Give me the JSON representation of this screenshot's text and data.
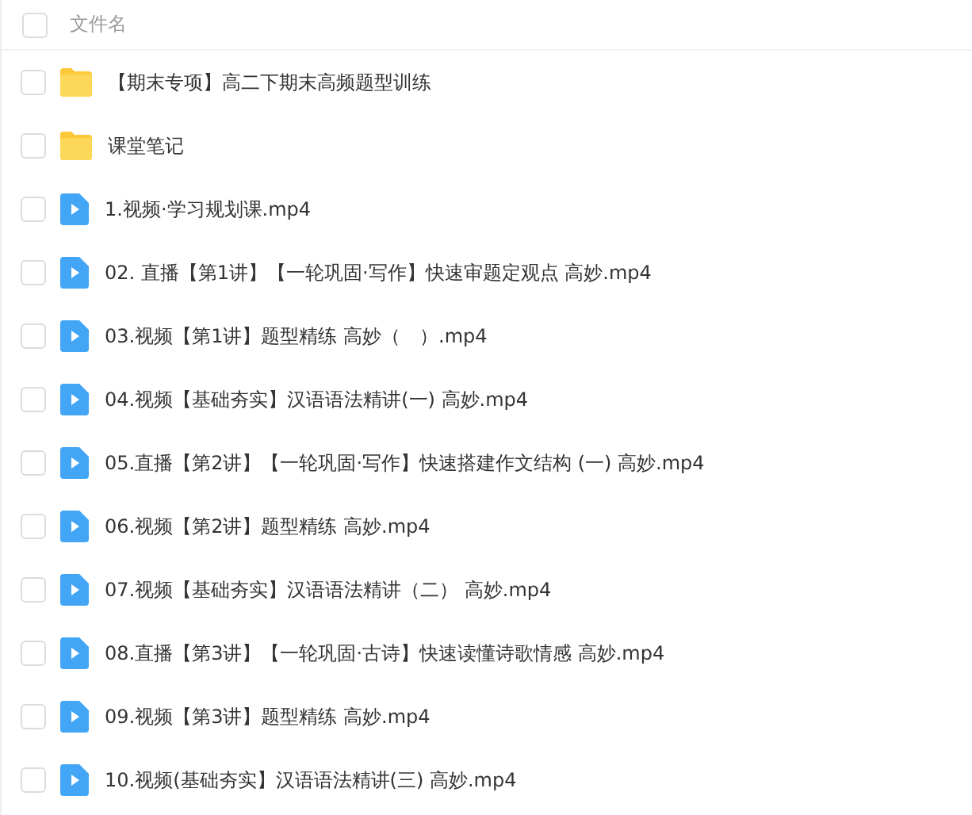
{
  "header": {
    "label": "文件名",
    "checked": false
  },
  "files": [
    {
      "kind": "folder",
      "name": "【期末专项】高二下期末高频题型训练",
      "checked": false
    },
    {
      "kind": "folder",
      "name": "课堂笔记",
      "checked": false
    },
    {
      "kind": "video",
      "name": "1.视频·学习规划课.mp4",
      "checked": false
    },
    {
      "kind": "video",
      "name": "02. 直播【第1讲】【一轮巩固·写作】快速审题定观点 高妙.mp4",
      "checked": false
    },
    {
      "kind": "video",
      "name": "03.视频【第1讲】题型精练 高妙（　）.mp4",
      "checked": false
    },
    {
      "kind": "video",
      "name": "04.视频【基础夯实】汉语语法精讲(一) 高妙.mp4",
      "checked": false
    },
    {
      "kind": "video",
      "name": "05.直播【第2讲】【一轮巩固·写作】快速搭建作文结构 (一) 高妙.mp4",
      "checked": false
    },
    {
      "kind": "video",
      "name": "06.视频【第2讲】题型精练 高妙.mp4",
      "checked": false
    },
    {
      "kind": "video",
      "name": "07.视频【基础夯实】汉语语法精讲（二） 高妙.mp4",
      "checked": false
    },
    {
      "kind": "video",
      "name": "08.直播【第3讲】【一轮巩固·古诗】快速读懂诗歌情感 高妙.mp4",
      "checked": false
    },
    {
      "kind": "video",
      "name": "09.视频【第3讲】题型精练 高妙.mp4",
      "checked": false
    },
    {
      "kind": "video",
      "name": "10.视频(基础夯实】汉语语法精讲(三) 高妙.mp4",
      "checked": false
    }
  ]
}
